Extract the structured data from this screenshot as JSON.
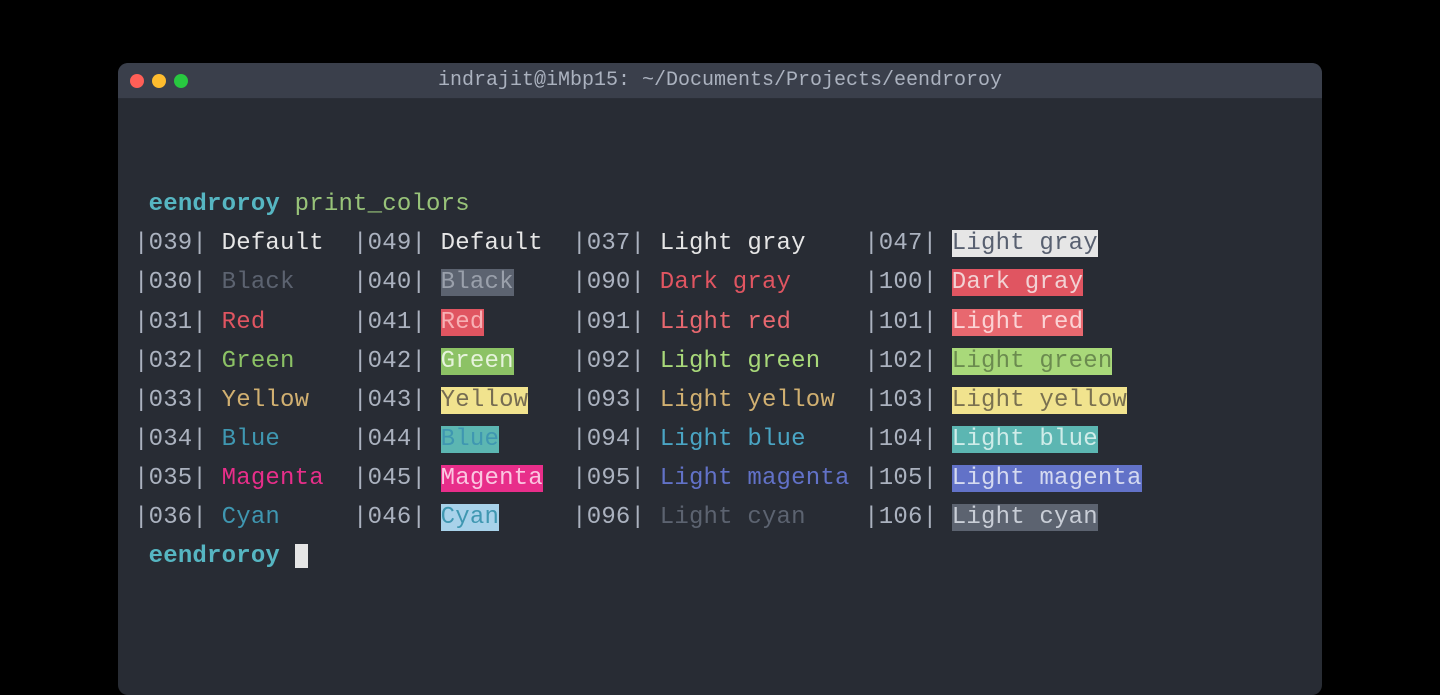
{
  "window": {
    "title": "indrajit@iMbp15: ~/Documents/Projects/eendroroy"
  },
  "prompt": {
    "dir": "eendroroy",
    "command": "print_colors"
  },
  "col_widths": {
    "name_fg": 9,
    "name_bright_fg": 14
  },
  "palette": {
    "text_default": "#abb2bf",
    "black": "#5c6370",
    "red": "#e06c75",
    "green": "#98c379",
    "yellow": "#e5c07b",
    "blue": "#61afef",
    "magenta": "#c678dd",
    "cyan": "#56b6c2",
    "light_gray": "#abb2bf",
    "dark_gray": "#5c6370",
    "light_red": "#e06c75",
    "light_green": "#98c379",
    "light_yellow": "#e5c07b",
    "light_blue": "#61afef",
    "light_magenta": "#c678dd",
    "light_cyan": "#56b6c2"
  },
  "rows": [
    {
      "fg": {
        "code": "039",
        "name": "Default",
        "style": {
          "color": "#e6e6e6"
        }
      },
      "bg": {
        "code": "049",
        "name": "Default",
        "style": {
          "color": "#e6e6e6"
        }
      },
      "bright_fg": {
        "code": "037",
        "name": "Light gray",
        "style": {
          "color": "#e6e6e6"
        }
      },
      "bright_bg": {
        "code": "047",
        "name": "Light gray",
        "style": {
          "color": "#586070",
          "background": "#e6e6e6"
        }
      }
    },
    {
      "fg": {
        "code": "030",
        "name": "Black",
        "style": {
          "color": "#5c6370"
        }
      },
      "bg": {
        "code": "040",
        "name": "Black",
        "style": {
          "color": "#9aa0ab",
          "background": "#5c6370"
        }
      },
      "bright_fg": {
        "code": "090",
        "name": "Dark gray",
        "style": {
          "color": "#e05561"
        }
      },
      "bright_bg": {
        "code": "100",
        "name": "Dark gray",
        "style": {
          "color": "#f2d2d4",
          "background": "#e05561"
        }
      }
    },
    {
      "fg": {
        "code": "031",
        "name": "Red",
        "style": {
          "color": "#e05561"
        }
      },
      "bg": {
        "code": "041",
        "name": "Red",
        "style": {
          "color": "#f7b0b4",
          "background": "#e05561"
        }
      },
      "bright_fg": {
        "code": "091",
        "name": "Light red",
        "style": {
          "color": "#e8686f"
        }
      },
      "bright_bg": {
        "code": "101",
        "name": "Light red",
        "style": {
          "color": "#fbd3d5",
          "background": "#e8686f"
        }
      }
    },
    {
      "fg": {
        "code": "032",
        "name": "Green",
        "style": {
          "color": "#8cc265"
        }
      },
      "bg": {
        "code": "042",
        "name": "Green",
        "style": {
          "color": "#e6f3dc",
          "background": "#8cc265"
        }
      },
      "bright_fg": {
        "code": "092",
        "name": "Light green",
        "style": {
          "color": "#a9d97a"
        }
      },
      "bright_bg": {
        "code": "102",
        "name": "Light green",
        "style": {
          "color": "#6b8b4f",
          "background": "#a9d97a"
        }
      }
    },
    {
      "fg": {
        "code": "033",
        "name": "Yellow",
        "style": {
          "color": "#d1b071"
        }
      },
      "bg": {
        "code": "043",
        "name": "Yellow",
        "style": {
          "color": "#766c52",
          "background": "#f1e38e"
        }
      },
      "bright_fg": {
        "code": "093",
        "name": "Light yellow",
        "style": {
          "color": "#d1b071"
        }
      },
      "bright_bg": {
        "code": "103",
        "name": "Light yellow",
        "style": {
          "color": "#7a7150",
          "background": "#f1e38e"
        }
      }
    },
    {
      "fg": {
        "code": "034",
        "name": "Blue",
        "style": {
          "color": "#3f97b1"
        }
      },
      "bg": {
        "code": "044",
        "name": "Blue",
        "style": {
          "color": "#3f97b1",
          "background": "#5cb6b2"
        }
      },
      "bright_fg": {
        "code": "094",
        "name": "Light blue",
        "style": {
          "color": "#4aa5c4"
        }
      },
      "bright_bg": {
        "code": "104",
        "name": "Light blue",
        "style": {
          "color": "#cfece9",
          "background": "#5cb6b2"
        }
      }
    },
    {
      "fg": {
        "code": "035",
        "name": "Magenta",
        "style": {
          "color": "#e82e8a"
        }
      },
      "bg": {
        "code": "045",
        "name": "Magenta",
        "style": {
          "color": "#fbc6e1",
          "background": "#e82e8a"
        }
      },
      "bright_fg": {
        "code": "095",
        "name": "Light magenta",
        "style": {
          "color": "#6272c8"
        }
      },
      "bright_bg": {
        "code": "105",
        "name": "Light magenta",
        "style": {
          "color": "#d5daf0",
          "background": "#6272c8"
        }
      }
    },
    {
      "fg": {
        "code": "036",
        "name": "Cyan",
        "style": {
          "color": "#3f97b1"
        }
      },
      "bg": {
        "code": "046",
        "name": "Cyan",
        "style": {
          "color": "#3f97b1",
          "background": "#a8d2ea"
        }
      },
      "bright_fg": {
        "code": "096",
        "name": "Light cyan",
        "style": {
          "color": "#5c6370"
        }
      },
      "bright_bg": {
        "code": "106",
        "name": "Light cyan",
        "style": {
          "color": "#c9ced7",
          "background": "#5c6370"
        }
      }
    }
  ]
}
